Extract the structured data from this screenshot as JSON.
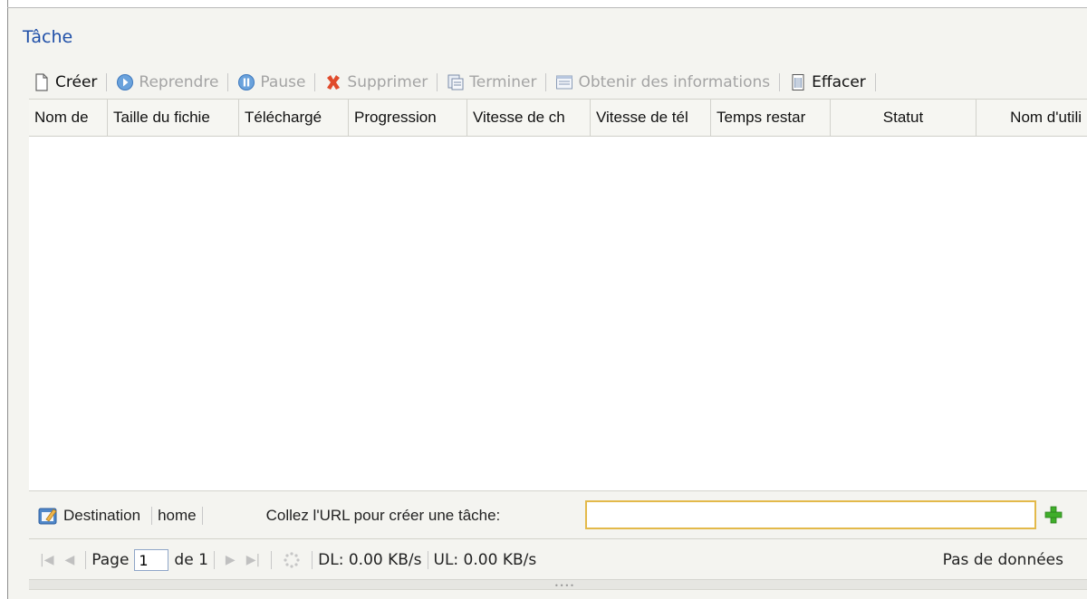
{
  "title": "Tâche",
  "toolbar": {
    "create": "Créer",
    "resume": "Reprendre",
    "pause": "Pause",
    "delete": "Supprimer",
    "finish": "Terminer",
    "info": "Obtenir des informations",
    "clear": "Effacer"
  },
  "grid": {
    "columns": [
      "Nom de",
      "Taille du fichie",
      "Téléchargé",
      "Progression",
      "Vitesse de ch",
      "Vitesse de tél",
      "Temps restar",
      "Statut",
      "Nom d'utili"
    ],
    "rows": []
  },
  "destination": {
    "label": "Destination",
    "value": "home",
    "url_prompt": "Collez l'URL pour créer une tâche:",
    "url_value": ""
  },
  "pager": {
    "page_label": "Page",
    "page_value": "1",
    "of_label": "de 1",
    "dl": "DL: 0.00 KB/s",
    "ul": "UL: 0.00 KB/s",
    "no_data": "Pas de données"
  },
  "colors": {
    "title": "#1f4fa8",
    "disabled_text": "#a4a4a4",
    "input_border": "#e3b94a",
    "add_icon": "#3fae2a"
  },
  "icons": [
    "new-file-icon",
    "resume-icon",
    "pause-icon",
    "delete-icon",
    "finish-icon",
    "info-icon",
    "clear-icon",
    "destination-icon",
    "add-icon",
    "first-page-icon",
    "prev-page-icon",
    "next-page-icon",
    "last-page-icon",
    "refresh-icon"
  ]
}
